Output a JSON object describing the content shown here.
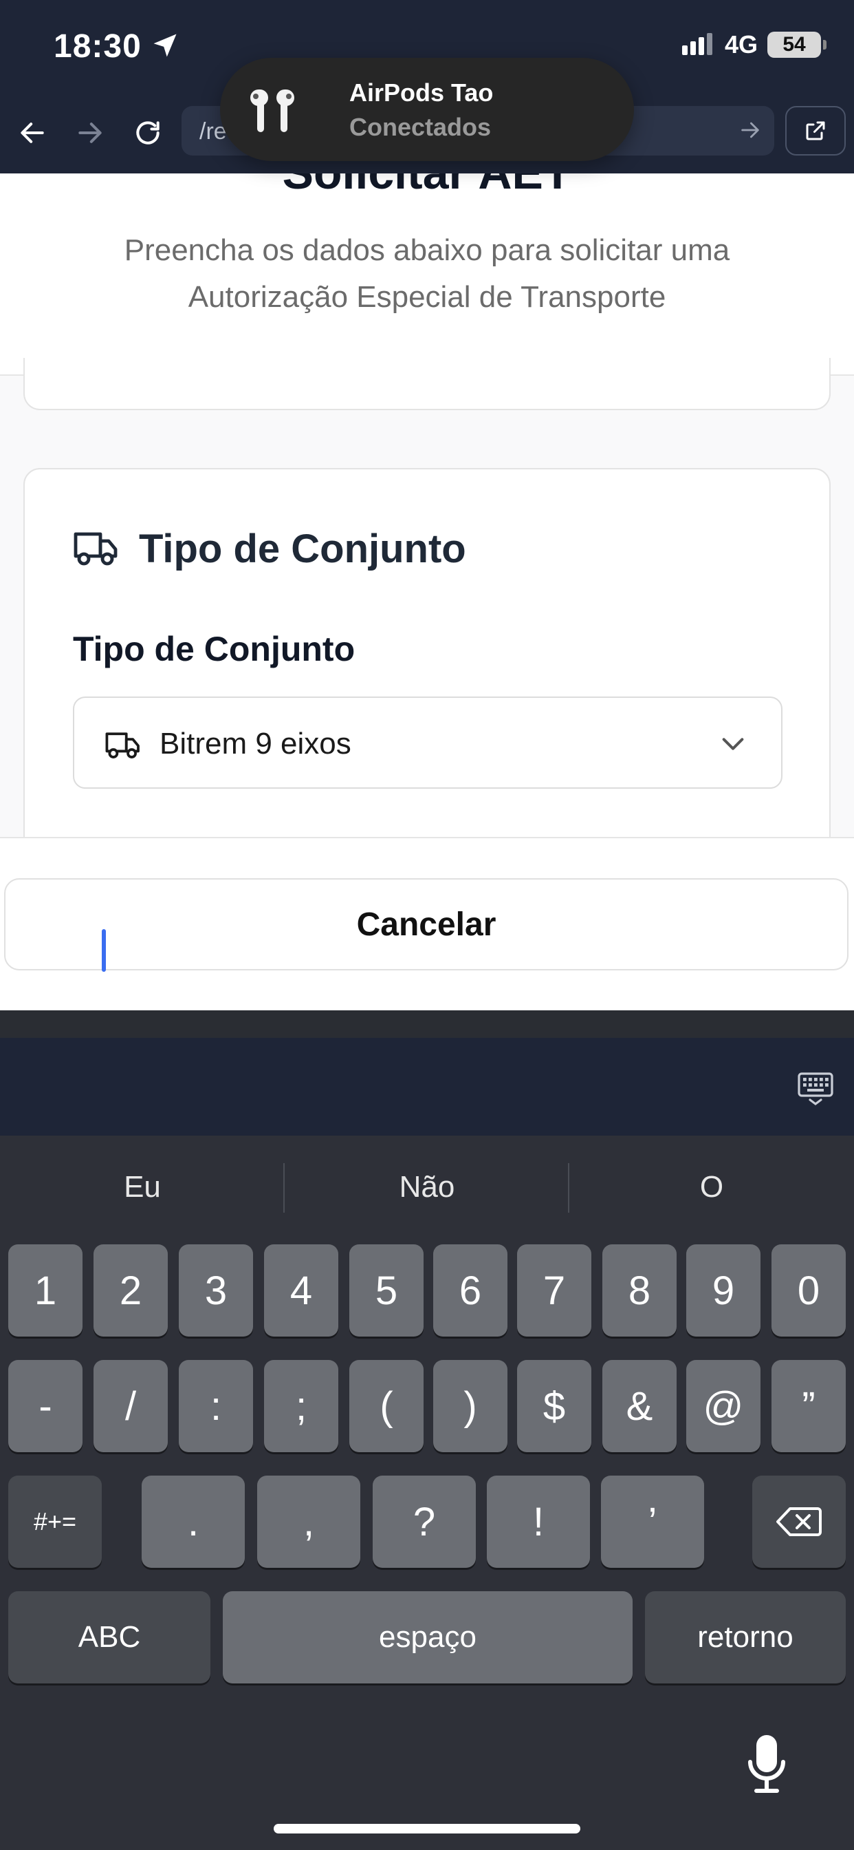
{
  "status": {
    "time": "18:30",
    "network": "4G",
    "battery": "54"
  },
  "browser": {
    "url": "/re"
  },
  "notification": {
    "title": "AirPods Tao",
    "subtitle": "Conectados"
  },
  "page": {
    "title": "Solicitar AET",
    "subtitle": "Preencha os dados abaixo para solicitar uma Autorização Especial de Transporte"
  },
  "section": {
    "title": "Tipo de Conjunto",
    "field_label": "Tipo de Conjunto",
    "selected": "Bitrem 9 eixos"
  },
  "footer": {
    "cancel": "Cancelar"
  },
  "keyboard": {
    "predictions": [
      "Eu",
      "Não",
      "O"
    ],
    "row1": [
      "1",
      "2",
      "3",
      "4",
      "5",
      "6",
      "7",
      "8",
      "9",
      "0"
    ],
    "row2": [
      "-",
      "/",
      ":",
      ";",
      "(",
      ")",
      "$",
      "&",
      "@",
      "”"
    ],
    "row3": [
      ".",
      ",",
      "?",
      "!",
      "’"
    ],
    "symbols_key": "#+=",
    "abc_key": "ABC",
    "space_key": "espaço",
    "return_key": "retorno"
  }
}
